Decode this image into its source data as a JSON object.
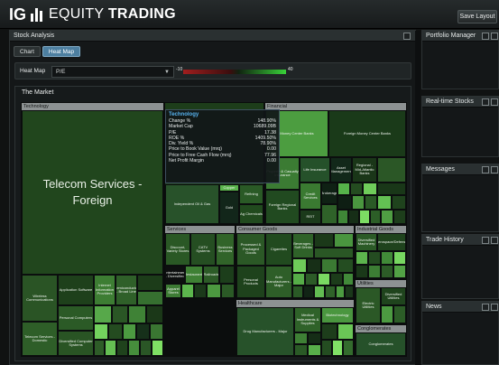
{
  "app": {
    "logo_ig": "IG",
    "logo_equity": "EQUITY",
    "logo_trading": "TRADING",
    "save_label": "Save Layout"
  },
  "main": {
    "panel_title": "Stock Analysis",
    "tabs": [
      {
        "label": "Chart"
      },
      {
        "label": "Heat Map"
      }
    ],
    "heatmap_label": "Heat Map",
    "heatmap_selected": "P/E",
    "legend_min": "-10",
    "legend_max": "40",
    "market_title": "The Market"
  },
  "treemap": {
    "sections": {
      "technology": "Technology",
      "financial": "Financial",
      "services": "Services",
      "consumer_goods": "Consumer Goods",
      "industrial_goods": "Industrial Goods",
      "healthcare": "Healthcare",
      "utilities": "Utilities",
      "conglomerates": "Conglomerates"
    },
    "cells": {
      "telecom_foreign": "Telecom Services - Foreign",
      "wireless": "Wireless Communications",
      "app_software": "Application Software",
      "internet_info": "Internet Information Providers",
      "semiconductor": "Semiconductor - Broad Line",
      "personal_computers": "Personal Computers",
      "telecom_domestic": "Telecom Services - Domestic",
      "diversified_computer": "Diversified Computer Systems",
      "money_center": "Money Center Banks",
      "foreign_money_center": "Foreign Money Center Banks",
      "property_casualty": "Property & Casualty Insurance",
      "life_insurance": "Life Insurance",
      "asset_mgmt": "Asset Management",
      "regional_mid_atlantic": "Regional - Mid-Atlantic Banks",
      "foreign_regional": "Foreign Regional Banks",
      "credit_services": "Credit Services",
      "brokerage": "Brokerage",
      "reit": "REIT",
      "independent_oil_gas": "Independent Oil & Gas",
      "gold": "Gold",
      "refining": "Refining",
      "ag_chem": "Ag Chemicals",
      "copper": "Copper",
      "discount_variety": "Discount, Variety Stores",
      "catv_systems": "CATV Systems",
      "business_services": "Business Services",
      "entertainment_diversified": "Entertainment - Diversified",
      "restaurants": "Restaurants",
      "railroads": "Railroads",
      "apparel_stores": "Apparel Stores",
      "processed_packaged": "Processed & Packaged Goods",
      "cigarettes": "Cigarettes",
      "beverages_soft": "Beverages - Soft Drinks",
      "personal_products": "Personal Products",
      "auto_manufacturers": "Auto Manufacturers - Major",
      "drug_manufacturers": "Drug Manufacturers - Major",
      "medical_instruments": "Medical Instruments & Supplies",
      "biotech": "Biotechnology",
      "diversified_machinery": "Diversified Machinery",
      "aerospace": "Aerospace/Defense",
      "electric_utilities": "Electric Utilities",
      "diversified_utilities": "Diversified Utilities",
      "conglomerates": "Conglomerates",
      "equipment": "Equipment"
    },
    "tooltip": {
      "title": "Technology",
      "rows": [
        {
          "label": "Change %",
          "value": "148.90%"
        },
        {
          "label": "Market Cap",
          "value": "10689.09B"
        },
        {
          "label": "P/E",
          "value": "17.38"
        },
        {
          "label": "ROE %",
          "value": "1409.50%"
        },
        {
          "label": "Div. Yield %",
          "value": "78.90%"
        },
        {
          "label": "Price to Book Value (mrq)",
          "value": "0.00"
        },
        {
          "label": "Price to Free Cash Flow (mrq)",
          "value": "77.96"
        },
        {
          "label": "Net Profit Margin",
          "value": "0.00"
        }
      ]
    }
  },
  "right_panels": [
    {
      "title": "Portfolio Manager"
    },
    {
      "title": "Real-time Stocks"
    },
    {
      "title": "Messages"
    },
    {
      "title": "Trade History"
    },
    {
      "title": "News"
    }
  ],
  "colors": {
    "accent": "#4d7fa0",
    "positive": "#39d239",
    "negative": "#a11e1e",
    "tooltip_title": "#58b3f0"
  },
  "icons": {
    "popout": "popout-icon",
    "maximize": "maximize-icon"
  }
}
